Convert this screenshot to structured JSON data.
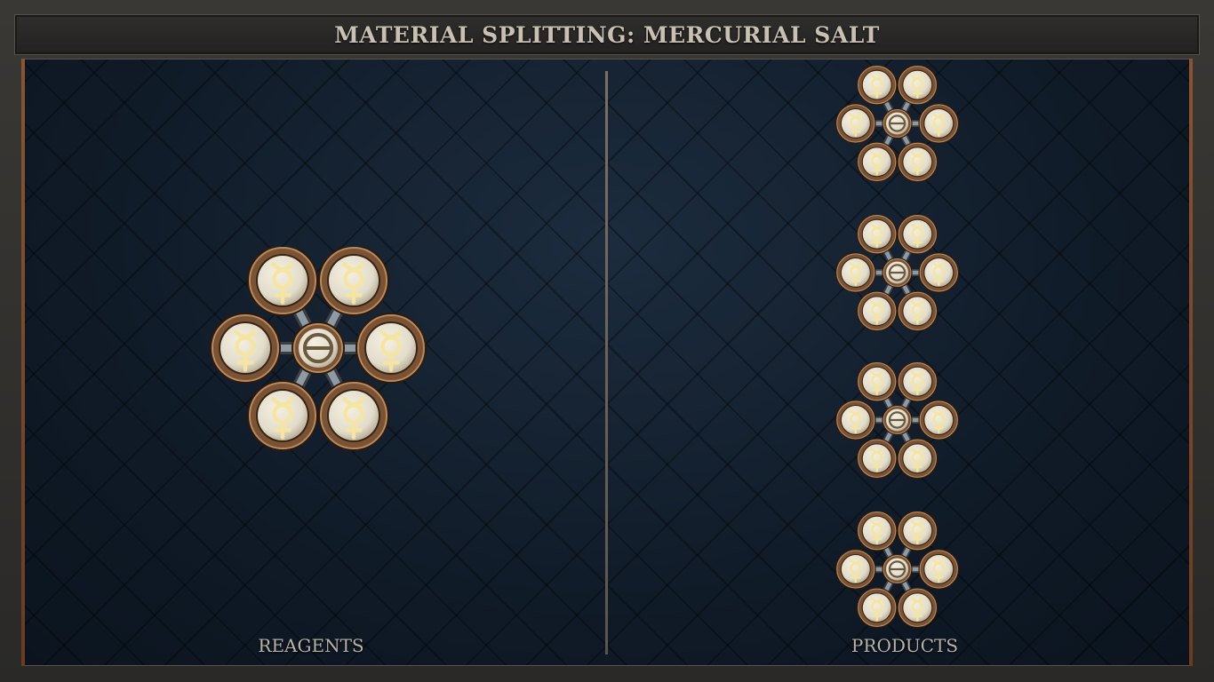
{
  "window": {
    "title": "MATERIAL SPLITTING: MERCURIAL SALT"
  },
  "sections": {
    "reagents_label": "REAGENTS",
    "products_label": "PRODUCTS"
  },
  "reagent": {
    "center_symbol": "salt",
    "outer_symbols": [
      "mercury",
      "mercury",
      "mercury",
      "mercury",
      "mercury",
      "mercury"
    ]
  },
  "products": [
    {
      "center_symbol": "salt",
      "outer_symbols": [
        "mercury",
        "mercury",
        "mercury",
        "mercury",
        "mercury",
        "mercury"
      ]
    },
    {
      "center_symbol": "salt",
      "outer_symbols": [
        "mercury",
        "mercury",
        "mercury",
        "mercury",
        "mercury",
        "mercury"
      ]
    },
    {
      "center_symbol": "salt",
      "outer_symbols": [
        "mercury",
        "mercury",
        "mercury",
        "mercury",
        "mercury",
        "mercury"
      ]
    },
    {
      "center_symbol": "salt",
      "outer_symbols": [
        "mercury",
        "mercury",
        "mercury",
        "mercury",
        "mercury",
        "mercury"
      ]
    }
  ],
  "colors": {
    "background": "#132030",
    "frame": "#2b2a28",
    "trim": "#8a5430",
    "bond": "#8e9aa4",
    "atom_fill": "#e2dccb",
    "atom_rim": "#7a5234",
    "glyph": "#f4e6a0"
  }
}
